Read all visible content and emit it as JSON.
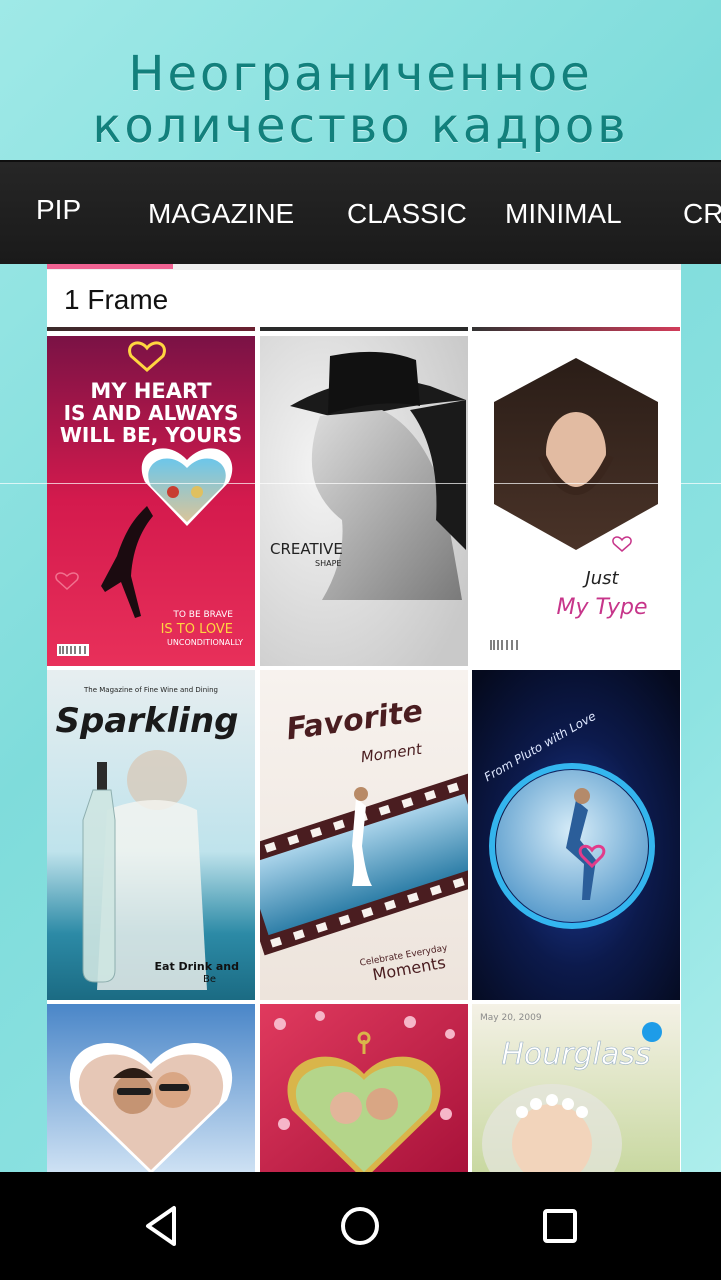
{
  "promo": {
    "line1": "Неограниченное",
    "line2": "количество кадров"
  },
  "tabs": [
    "PIP",
    "MAGAZINE",
    "CLASSIC",
    "MINIMAL",
    "CR"
  ],
  "active_tab_index": 0,
  "section": {
    "title": "1 Frame"
  },
  "colors": {
    "accent": "#f06292",
    "promo_text": "#12807c",
    "tab_bar": "#1f1f1f",
    "nav_bar": "#000000"
  },
  "templates": {
    "t1": {
      "l1": "MY HEART",
      "l2": "IS AND ALWAYS",
      "l3": "WILL BE, YOURS",
      "small1": "TO BE BRAVE",
      "small2": "IS TO LOVE",
      "small3": "UNCONDITIONALLY"
    },
    "t2": {
      "l1": "CREATIVE",
      "l2": "SHAPE"
    },
    "t3": {
      "l1": "Just",
      "l2": "My Type"
    },
    "t4": {
      "top": "The Magazine of Fine Wine and Dining",
      "title": "Sparkling",
      "l1": "Eat Drink and",
      "l2": "Be"
    },
    "t5": {
      "title": "Favorite",
      "sub": "Moment",
      "l1": "Celebrate Everyday",
      "l2": "Moments"
    },
    "t6": {
      "title": "From Pluto with Love"
    },
    "t9": {
      "date": "May 20, 2009",
      "title": "Hourglass"
    }
  },
  "nav": {
    "back_icon": "back-triangle-icon",
    "home_icon": "home-circle-icon",
    "recent_icon": "recent-square-icon"
  }
}
